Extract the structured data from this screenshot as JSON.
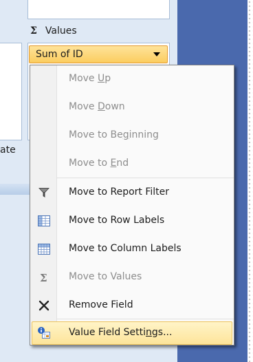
{
  "values_area": {
    "sigma_label": "Σ",
    "title": "Values",
    "field_button_label": "Sum of ID",
    "cut_text": "ate"
  },
  "context_menu": {
    "items": [
      {
        "pre": "Move ",
        "key": "U",
        "post": "p",
        "disabled": true,
        "icon": ""
      },
      {
        "pre": "Move ",
        "key": "D",
        "post": "own",
        "disabled": true,
        "icon": ""
      },
      {
        "pre": "Move to Be",
        "key": "g",
        "post": "inning",
        "disabled": true,
        "icon": ""
      },
      {
        "pre": "Move to ",
        "key": "E",
        "post": "nd",
        "disabled": true,
        "icon": ""
      },
      {
        "pre": "Move to Report Filter",
        "key": "",
        "post": "",
        "disabled": false,
        "icon": "filter-icon"
      },
      {
        "pre": "Move to Row Labels",
        "key": "",
        "post": "",
        "disabled": false,
        "icon": "row-labels-icon"
      },
      {
        "pre": "Move to Column Labels",
        "key": "",
        "post": "",
        "disabled": false,
        "icon": "column-labels-icon"
      },
      {
        "pre": "Move to Values",
        "key": "",
        "post": "",
        "disabled": true,
        "icon": "sigma-icon"
      },
      {
        "pre": "Remove Field",
        "key": "",
        "post": "",
        "disabled": false,
        "icon": "remove-x-icon"
      },
      {
        "pre": "Value Field Setti",
        "key": "n",
        "post": "gs...",
        "disabled": false,
        "icon": "value-field-settings-icon",
        "highlighted": true
      }
    ]
  },
  "colors": {
    "highlight": "#fde49a",
    "field_button": "#fbcd5f",
    "panel": "#dfe9f5",
    "background_blue": "#4a69ad"
  }
}
